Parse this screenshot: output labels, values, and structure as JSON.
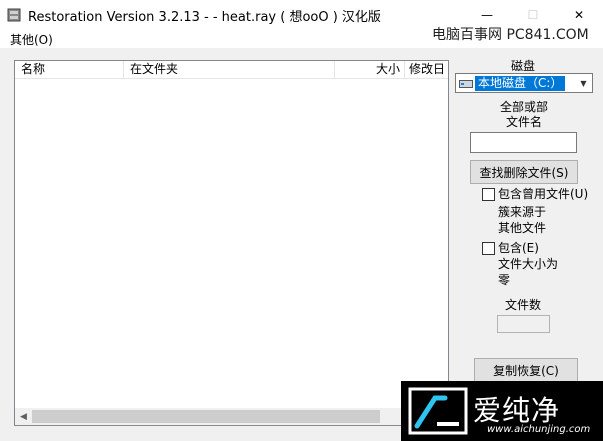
{
  "window": {
    "title": "Restoration Version 3.2.13   -  - heat.ray ( 想ooO ) 汉化版",
    "min_glyph": "—",
    "max_glyph": "☐",
    "close_glyph": "✕"
  },
  "menu": {
    "items": [
      {
        "label": "其他(O)"
      }
    ]
  },
  "watermark_top": "电脑百事网 PC841.COM",
  "list": {
    "columns": [
      "名称",
      "在文件夹",
      "大小",
      "修改日"
    ],
    "rows": []
  },
  "panel": {
    "drive_label": "磁盘",
    "drive_value": "本地磁盘（C:）",
    "filename_label": "全部或部\n文件名",
    "filename_value": "",
    "find_button": "查找删除文件(S)",
    "include_used_label": "包含曾用文件(U)",
    "include_used_desc": "簇来源于\n其他文件",
    "include_zero_label": "包含(E)",
    "include_zero_desc": "文件大小为\n零",
    "file_count_label": "文件数",
    "file_count_value": "",
    "restore_button": "复制恢复(C)"
  },
  "watermark_bottom": {
    "brand": "爱纯净",
    "url": "www.aichunjing.com"
  },
  "colors": {
    "selection": "#0078d7",
    "watermark_accent": "#2ec4f0"
  }
}
